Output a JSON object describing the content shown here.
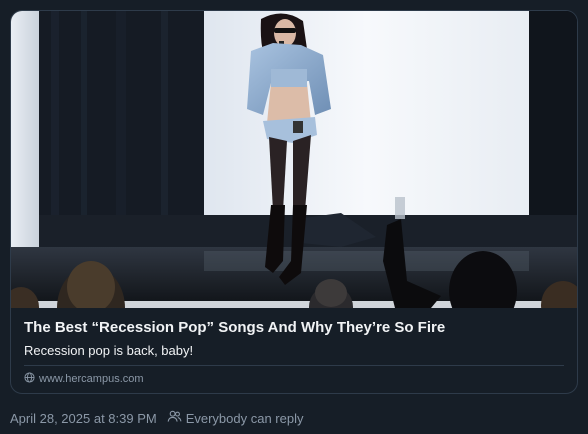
{
  "link_card": {
    "title": "The Best “Recession Pop” Songs And Why They’re So Fire",
    "description": "Recession pop is back, baby!",
    "domain": "www.hercampus.com",
    "domain_icon": "globe-icon",
    "image_subject": "performer-on-stage-photo"
  },
  "post_footer": {
    "timestamp": "April 28, 2025 at 8:39 PM",
    "reply_icon": "people-icon",
    "reply_setting": "Everybody can reply"
  },
  "colors": {
    "background": "#161e27",
    "card_border": "#2e3b4a",
    "primary_text": "#f1f3f5",
    "secondary_text": "#8b98a7"
  }
}
